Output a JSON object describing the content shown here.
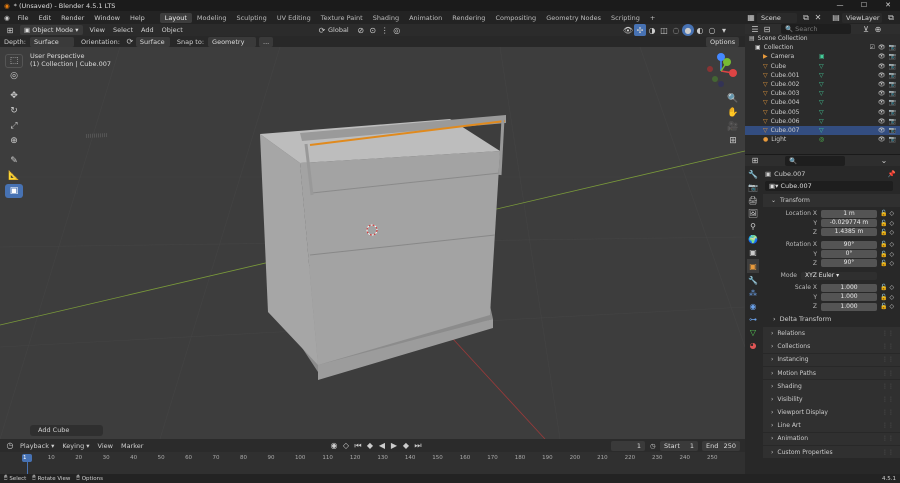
{
  "window": {
    "title": "* (Unsaved) - Blender 4.5.1 LTS",
    "min": "—",
    "max": "☐",
    "close": "✕"
  },
  "menu": [
    "File",
    "Edit",
    "Render",
    "Window",
    "Help"
  ],
  "workspaces": [
    {
      "label": "Layout",
      "active": true
    },
    {
      "label": "Modeling"
    },
    {
      "label": "Sculpting"
    },
    {
      "label": "UV Editing"
    },
    {
      "label": "Texture Paint"
    },
    {
      "label": "Shading"
    },
    {
      "label": "Animation"
    },
    {
      "label": "Rendering"
    },
    {
      "label": "Compositing"
    },
    {
      "label": "Geometry Nodes"
    },
    {
      "label": "Scripting"
    },
    {
      "label": "+"
    }
  ],
  "scene": {
    "name": "Scene",
    "view_layer": "ViewLayer"
  },
  "viewport_header": {
    "mode": "Object Mode",
    "view": "View",
    "select": "Select",
    "add": "Add",
    "object": "Object",
    "transform": "Global",
    "options": "Options"
  },
  "tool_settings": {
    "depth_label": "Depth:",
    "depth": "Surface",
    "orientation_label": "Orientation:",
    "orientation": "Surface",
    "snap_label": "Snap to:",
    "snap": "Geometry",
    "more": "..."
  },
  "overlay_text": {
    "line1": "User Perspective",
    "line2": "(1) Collection | Cube.007"
  },
  "last_op": "Add Cube",
  "outliner": {
    "search_placeholder": "Search",
    "root": "Scene Collection",
    "collection": "Collection",
    "items": [
      {
        "name": "Camera",
        "type": "camera"
      },
      {
        "name": "Cube",
        "type": "mesh"
      },
      {
        "name": "Cube.001",
        "type": "mesh"
      },
      {
        "name": "Cube.002",
        "type": "mesh"
      },
      {
        "name": "Cube.003",
        "type": "mesh"
      },
      {
        "name": "Cube.004",
        "type": "mesh"
      },
      {
        "name": "Cube.005",
        "type": "mesh"
      },
      {
        "name": "Cube.006",
        "type": "mesh"
      },
      {
        "name": "Cube.007",
        "type": "mesh",
        "selected": true
      },
      {
        "name": "Light",
        "type": "light"
      }
    ]
  },
  "properties": {
    "object_name": "Cube.007",
    "object_name_field": "Cube.007",
    "transform_label": "Transform",
    "location": {
      "label": "Location X",
      "x": "1 m",
      "y": "-0.029774 m",
      "z": "1.4385 m"
    },
    "rotation": {
      "label": "Rotation X",
      "x": "90°",
      "y": "0°",
      "z": "90°"
    },
    "mode": {
      "label": "Mode",
      "value": "XYZ Euler"
    },
    "scale": {
      "label": "Scale X",
      "x": "1.000",
      "y": "1.000",
      "z": "1.000"
    },
    "delta": "Delta Transform",
    "sections": [
      "Relations",
      "Collections",
      "Instancing",
      "Motion Paths",
      "Shading",
      "Visibility",
      "Viewport Display",
      "Line Art",
      "Animation",
      "Custom Properties"
    ],
    "axis": {
      "y": "Y",
      "z": "Z"
    }
  },
  "timeline": {
    "playback": "Playback",
    "keying": "Keying",
    "view": "View",
    "marker": "Marker",
    "current_frame": "1",
    "start_label": "Start",
    "start": "1",
    "end_label": "End",
    "end": "250",
    "ticks": [
      "1",
      "10",
      "20",
      "30",
      "40",
      "50",
      "60",
      "70",
      "80",
      "90",
      "100",
      "110",
      "120",
      "130",
      "140",
      "150",
      "160",
      "170",
      "180",
      "190",
      "200",
      "210",
      "220",
      "230",
      "240",
      "250"
    ]
  },
  "statusbar": {
    "select": "Select",
    "rotate": "Rotate View",
    "options": "Options",
    "version": "4.5.1"
  }
}
